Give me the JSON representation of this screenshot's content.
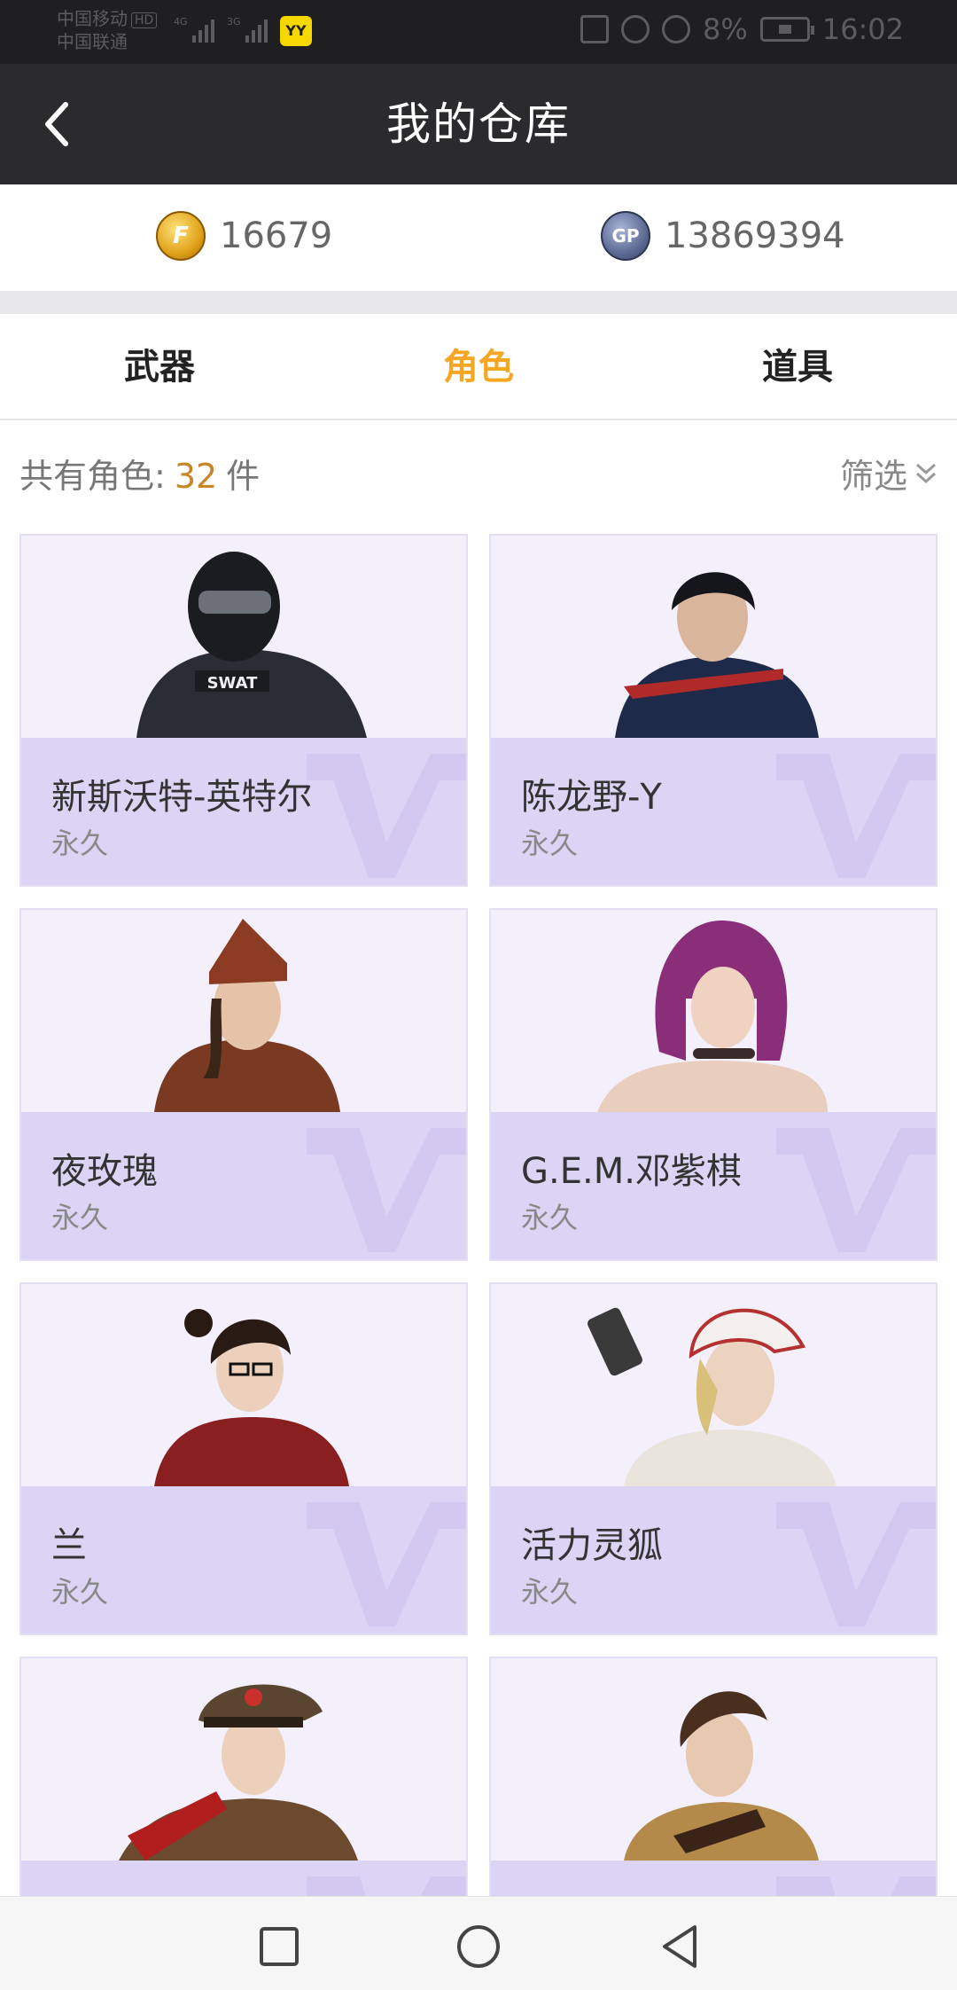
{
  "status_bar": {
    "carrier_1": "中国移动",
    "carrier_1_badge": "HD",
    "carrier_2": "中国联通",
    "signal_1_tag": "4G",
    "signal_2_tag": "3G",
    "app_badge": "YY",
    "battery": "8%",
    "time": "16:02"
  },
  "header": {
    "title": "我的仓库",
    "back_icon": "chevron-left-icon"
  },
  "currency": {
    "cf_points": "16679",
    "gp_points": "13869394"
  },
  "tabs": [
    {
      "label": "武器",
      "active": false
    },
    {
      "label": "角色",
      "active": true
    },
    {
      "label": "道具",
      "active": false
    }
  ],
  "summary": {
    "prefix": "共有角色:",
    "count": "32",
    "suffix": "件",
    "filter_label": "筛选"
  },
  "characters": [
    {
      "name": "新斯沃特-英特尔",
      "duration": "永久"
    },
    {
      "name": "陈龙野-Y",
      "duration": "永久"
    },
    {
      "name": "夜玫瑰",
      "duration": "永久"
    },
    {
      "name": "G.E.M.邓紫棋",
      "duration": "永久"
    },
    {
      "name": "兰",
      "duration": "永久"
    },
    {
      "name": "活力灵狐",
      "duration": "永久"
    },
    {
      "name": "",
      "duration": ""
    },
    {
      "name": "",
      "duration": ""
    }
  ],
  "colors": {
    "accent": "#f5a623",
    "header_bg": "#2b2b2d",
    "card_bg": "#f3f0fb",
    "card_info_bg": "#dcd4f4"
  }
}
